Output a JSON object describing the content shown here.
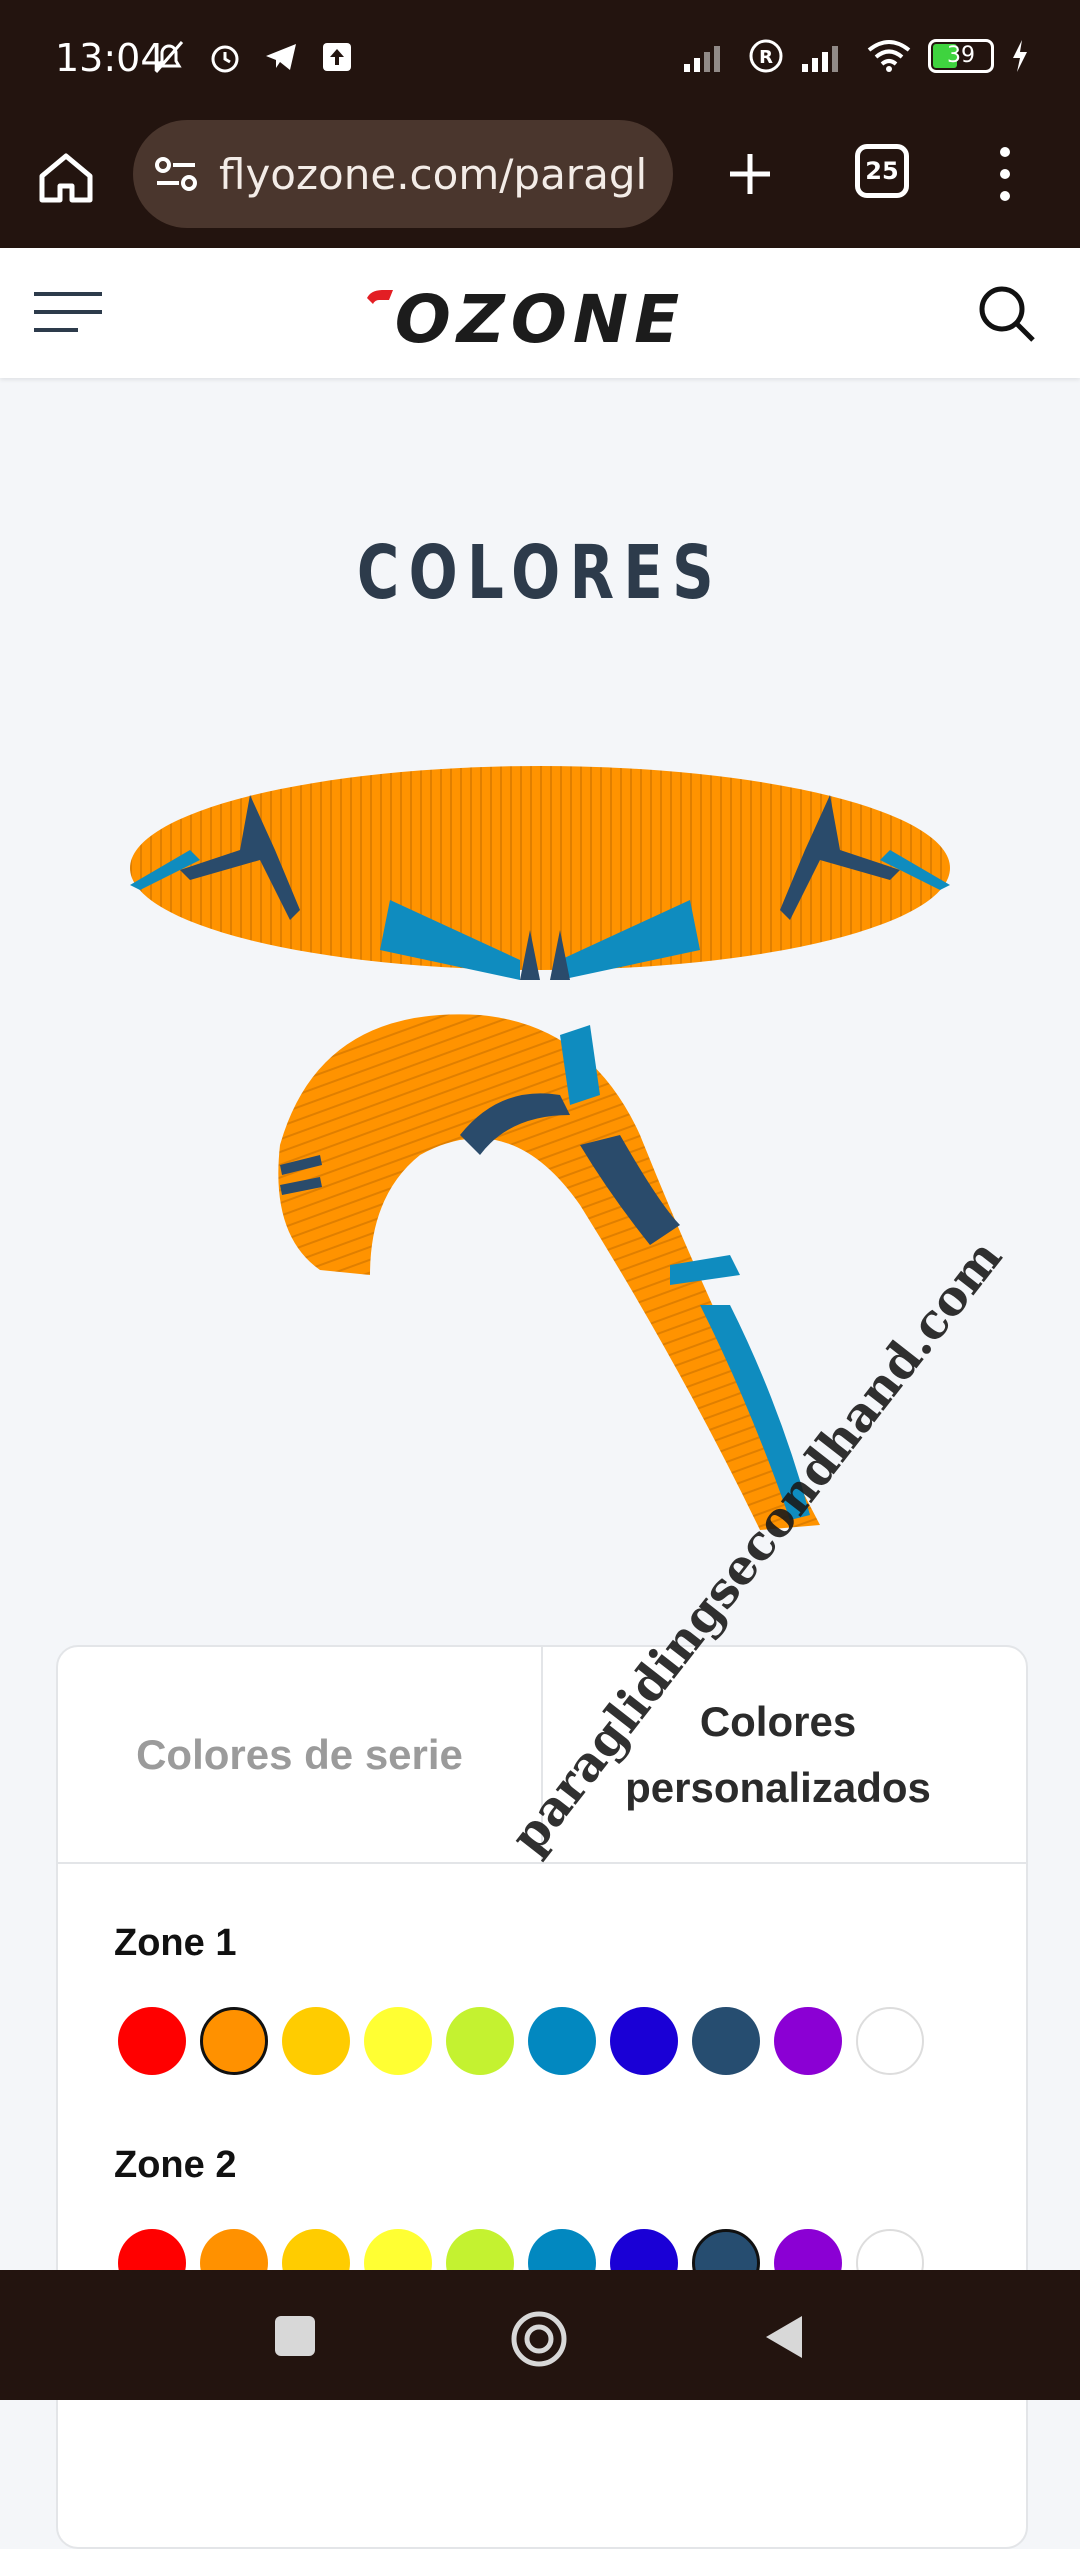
{
  "status": {
    "time": "13:04",
    "battery": "39"
  },
  "browser": {
    "url": "flyozone.com/paraglic",
    "tab_count": "25"
  },
  "site": {
    "logo_text": "OZONE"
  },
  "page": {
    "title": "COLORES"
  },
  "tabs": [
    {
      "label": "Colores de serie",
      "active": false
    },
    {
      "label": "Colores personalizados",
      "active": true
    }
  ],
  "colors": [
    "#ff0000",
    "#ff9100",
    "#ffcc00",
    "#ffff33",
    "#c4f230",
    "#0288c0",
    "#1a00d6",
    "#264d70",
    "#8b00d4",
    "#ffffff"
  ],
  "zones": [
    {
      "label": "Zone 1",
      "selected": 1
    },
    {
      "label": "Zone 2",
      "selected": 7
    }
  ],
  "watermark": "paraglidingsecondhand.com"
}
